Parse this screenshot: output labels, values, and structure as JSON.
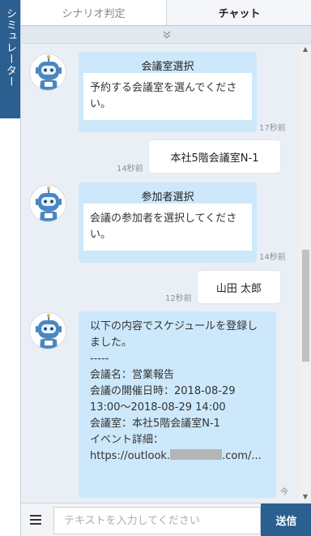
{
  "side_tab": {
    "label": "シミュレーター"
  },
  "tabs": [
    {
      "label": "シナリオ判定",
      "active": false
    },
    {
      "label": "チャット",
      "active": true
    }
  ],
  "collapse_icon": "double-chevron-down-icon",
  "messages": [
    {
      "from": "bot",
      "title": "会議室選択",
      "body": "予約する会議室を選んでください。",
      "time": "17秒前"
    },
    {
      "from": "user",
      "text": "本社5階会議室N-1",
      "time": "14秒前"
    },
    {
      "from": "bot",
      "title": "参加者選択",
      "body": "会議の参加者を選択してください。",
      "time": "14秒前"
    },
    {
      "from": "user",
      "text": "山田 太郎",
      "time": "12秒前"
    },
    {
      "from": "bot",
      "text_before_redaction": "以下の内容でスケジュールを登録しました。\n-----\n会議名：営業報告\n会議の開催日時：2018-08-29 13:00～2018-08-29 14:00\n会議室：本社5階会議室N-1\nイベント詳細：\nhttps://outlook.",
      "text_after_redaction": ".com/...",
      "time": "今"
    }
  ],
  "input": {
    "placeholder": "テキストを入力してください",
    "value": ""
  },
  "send_button": {
    "label": "送信"
  },
  "colors": {
    "accent": "#2a5f8f",
    "bot_bubble": "#cde8fb",
    "chat_background": "#eaeff5"
  }
}
